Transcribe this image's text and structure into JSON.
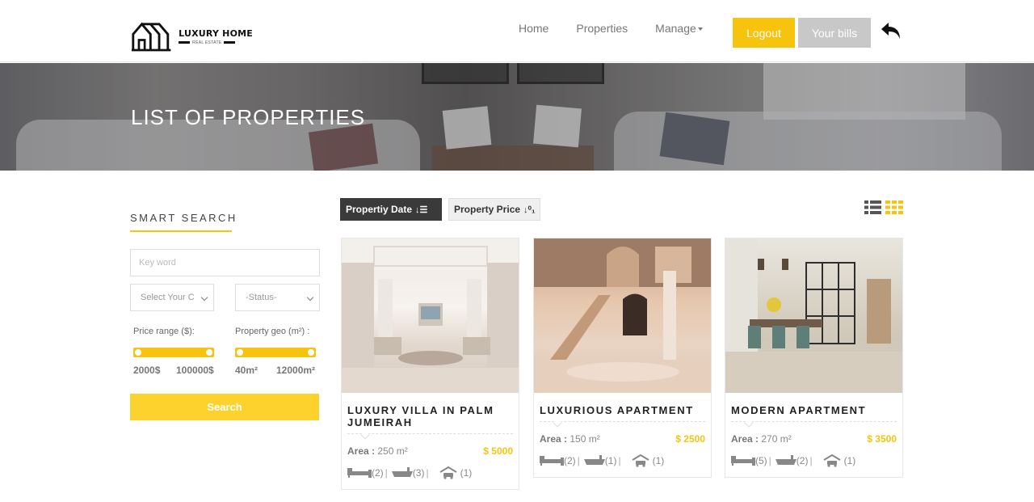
{
  "header": {
    "logo": {
      "title": "LUXURY HOME",
      "subtitle": "REAL ESTATE"
    },
    "nav": [
      {
        "label": "Home"
      },
      {
        "label": "Properties"
      },
      {
        "label": "Manage"
      }
    ],
    "logout_label": "Logout",
    "bills_label": "Your bills",
    "back_icon": "back-arrow-icon"
  },
  "banner": {
    "title": "LIST OF PROPERTIES"
  },
  "smart_search": {
    "title": "SMART SEARCH",
    "keyword_placeholder": "Key word",
    "country_select": "Select Your C",
    "status_select": "-Status-",
    "price_range": {
      "label": "Price range ($):",
      "min": "2000$",
      "max": "100000$"
    },
    "geo_range": {
      "label": "Property geo (m²) :",
      "min": "40m²",
      "max": "12000m²"
    },
    "search_label": "Search"
  },
  "sort": {
    "date_label": "Propertiy Date",
    "price_label": "Property Price"
  },
  "view_toggle": {
    "list_icon": "list-view-icon",
    "grid_icon": "grid-view-icon",
    "active": "grid",
    "active_color": "#f6c30e"
  },
  "listings": [
    {
      "title": "LUXURY VILLA IN PALM JUMEIRAH",
      "area_label": "Area :",
      "area": "250 m²",
      "price": "$ 5000",
      "beds": "(2)",
      "baths": "(3)",
      "garage": "(1)"
    },
    {
      "title": "LUXURIOUS APARTMENT",
      "area_label": "Area :",
      "area": "150 m²",
      "price": "$ 2500",
      "beds": "(2)",
      "baths": "(1)",
      "garage": "(1)"
    },
    {
      "title": "MODERN APARTMENT",
      "area_label": "Area :",
      "area": "270 m²",
      "price": "$ 3500",
      "beds": "(5)",
      "baths": "(2)",
      "garage": "(1)"
    }
  ],
  "colors": {
    "accent": "#f6c30e",
    "dark": "#3a3a3a",
    "muted": "#c8c8c8"
  }
}
